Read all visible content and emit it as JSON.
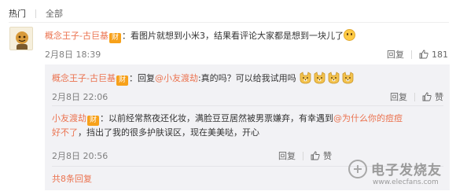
{
  "tabs": {
    "hot": "热门",
    "all": "全部"
  },
  "main_comment": {
    "user": "概念王子-古巨基",
    "badge": "财",
    "text": "：看图片就想到小米3，结果看评论大家都是想到一块儿了",
    "time": "2月8日 18:39",
    "reply_label": "回复",
    "like_count": "181"
  },
  "replies": [
    {
      "user": "概念王子-古巨基",
      "badge": "财",
      "prefix": "：回复",
      "mention": "@小友渡劫",
      "text": ":真的吗？可以给我试用吗",
      "time": "2月8日 22:06",
      "reply_label": "回复",
      "like_label": "赞"
    },
    {
      "user": "小友渡劫",
      "badge": "财",
      "text_a": "：以前经常熬夜还化妆，满脸豆豆居然被男票嫌弃，有幸遇到",
      "mention": "@为什么你的痘痘",
      "line2_mention": "好不了",
      "text_b": "，挡出了我的很多护肤误区，现在美美哒，开心",
      "time": "2月8日 20:56",
      "reply_label": "回复",
      "like_label": "赞"
    }
  ],
  "more_replies": "共8条回复",
  "watermark": {
    "cn": "电子发烧友",
    "url": "www.elecfans.com"
  },
  "colors": {
    "accent": "#eb7350",
    "badge": "#f7a11a",
    "muted": "#808080"
  },
  "icons": [
    "avatar-cartoon",
    "grin-emoji",
    "dog-emoji",
    "share-icon",
    "thumb-up-icon"
  ]
}
